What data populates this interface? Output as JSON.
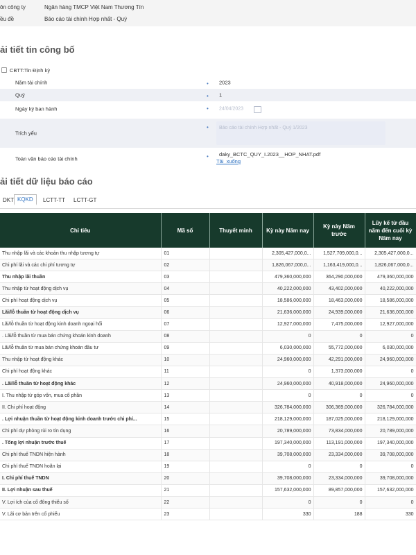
{
  "company": {
    "label": "ôn công ty",
    "value": "Ngân hàng TMCP Việt Nam Thương Tín"
  },
  "subject": {
    "label": "ều đề",
    "value": "Báo cáo tài chính Hợp nhất - Quý"
  },
  "section1_title": "ải tiết tin công bố",
  "cbtt": "CBTT:Tin Định kỳ",
  "fields": [
    {
      "label": "Năm tài chính",
      "value": "2023"
    },
    {
      "label": "Quý",
      "value": "1"
    },
    {
      "label": "Ngày ký ban hành",
      "value": "24/04/2023"
    },
    {
      "label": "Trích yếu",
      "value": "Báo cáo tài chính Hợp nhất - Quý 1/2023"
    },
    {
      "label": "Toàn văn báo cáo tài chính",
      "value": "daky_BCTC_QUY_I.2023__HOP_NHAT.pdf",
      "link": "Tải_xuống"
    }
  ],
  "section2_title": "ải tiết dữ liệu báo cáo",
  "tabs": [
    "DKT",
    "KQKD",
    "LCTT-TT",
    "LCTT-GT"
  ],
  "active_tab": 1,
  "table": {
    "headers": [
      "Chỉ tiêu",
      "Mã số",
      "Thuyết minh",
      "Kỳ này Năm nay",
      "Kỳ này Năm trước",
      "Lũy kế từ đầu năm đến cuối kỳ Năm nay"
    ],
    "rows": [
      {
        "name": "Thu nhập lãi và các khoản thu nhập tương tự",
        "code": "01",
        "note": "",
        "cur": "2,305,427,000,0...",
        "prev": "1,527,709,000,0...",
        "ytd": "2,305,427,000,0...",
        "bold": false
      },
      {
        "name": "Chi phí lãi và các chi phí tương tự",
        "code": "02",
        "note": "",
        "cur": "1,826,067,000,0...",
        "prev": "1,163,419,000,0...",
        "ytd": "1,826,067,000,0...",
        "bold": false
      },
      {
        "name": "Thu nhập lãi thuần",
        "code": "03",
        "note": "",
        "cur": "479,360,000,000",
        "prev": "364,290,000,000",
        "ytd": "479,360,000,000",
        "bold": true
      },
      {
        "name": "Thu nhập từ hoạt động dịch vụ",
        "code": "04",
        "note": "",
        "cur": "40,222,000,000",
        "prev": "43,402,000,000",
        "ytd": "40,222,000,000",
        "bold": false
      },
      {
        "name": "Chi phí hoạt động dịch vụ",
        "code": "05",
        "note": "",
        "cur": "18,586,000,000",
        "prev": "18,463,000,000",
        "ytd": "18,586,000,000",
        "bold": false
      },
      {
        "name": "Lãi/lỗ thuần từ hoạt động dịch vụ",
        "code": "06",
        "note": "",
        "cur": "21,636,000,000",
        "prev": "24,939,000,000",
        "ytd": "21,636,000,000",
        "bold": true
      },
      {
        "name": "Lãi/lỗ thuần từ hoạt động kinh doanh ngoại hối",
        "code": "07",
        "note": "",
        "cur": "12,927,000,000",
        "prev": "7,475,000,000",
        "ytd": "12,927,000,000",
        "bold": false
      },
      {
        "name": ". Lãi/lỗ thuần từ mua bán chứng khoán kinh doanh",
        "code": "08",
        "note": "",
        "cur": "0",
        "prev": "0",
        "ytd": "0",
        "bold": false
      },
      {
        "name": "Lãi/lỗ thuần từ mua bán chứng khoán đầu tư",
        "code": "09",
        "note": "",
        "cur": "6,030,000,000",
        "prev": "55,772,000,000",
        "ytd": "6,030,000,000",
        "bold": false
      },
      {
        "name": "Thu nhập từ hoạt động khác",
        "code": "10",
        "note": "",
        "cur": "24,960,000,000",
        "prev": "42,291,000,000",
        "ytd": "24,960,000,000",
        "bold": false
      },
      {
        "name": "Chi phí hoạt động khác",
        "code": "11",
        "note": "",
        "cur": "0",
        "prev": "1,373,000,000",
        "ytd": "0",
        "bold": false
      },
      {
        "name": ". Lãi/lỗ thuần từ hoạt động khác",
        "code": "12",
        "note": "",
        "cur": "24,960,000,000",
        "prev": "40,918,000,000",
        "ytd": "24,960,000,000",
        "bold": true
      },
      {
        "name": "I. Thu nhập từ góp vốn, mua cổ phần",
        "code": "13",
        "note": "",
        "cur": "0",
        "prev": "0",
        "ytd": "0",
        "bold": false
      },
      {
        "name": "II. Chi phí hoạt động",
        "code": "14",
        "note": "",
        "cur": "326,784,000,000",
        "prev": "306,369,000,000",
        "ytd": "326,784,000,000",
        "bold": false
      },
      {
        "name": ". Lợi nhuận thuần từ hoạt động kinh doanh trước chi phí...",
        "code": "15",
        "note": "",
        "cur": "218,129,000,000",
        "prev": "187,025,000,000",
        "ytd": "218,129,000,000",
        "bold": true
      },
      {
        "name": "Chi phí dự phòng rủi ro tín dụng",
        "code": "16",
        "note": "",
        "cur": "20,789,000,000",
        "prev": "73,834,000,000",
        "ytd": "20,789,000,000",
        "bold": false
      },
      {
        "name": ". Tổng lợi nhuận trước thuế",
        "code": "17",
        "note": "",
        "cur": "197,340,000,000",
        "prev": "113,191,000,000",
        "ytd": "197,340,000,000",
        "bold": true
      },
      {
        "name": "Chi phí thuế TNDN hiện hành",
        "code": "18",
        "note": "",
        "cur": "39,708,000,000",
        "prev": "23,334,000,000",
        "ytd": "39,708,000,000",
        "bold": false
      },
      {
        "name": "Chi phí thuế TNDN hoãn lại",
        "code": "19",
        "note": "",
        "cur": "0",
        "prev": "0",
        "ytd": "0",
        "bold": false
      },
      {
        "name": "I. Chi phí thuế TNDN",
        "code": "20",
        "note": "",
        "cur": "39,708,000,000",
        "prev": "23,334,000,000",
        "ytd": "39,708,000,000",
        "bold": true
      },
      {
        "name": "II. Lợi nhuận sau thuế",
        "code": "21",
        "note": "",
        "cur": "157,632,000,000",
        "prev": "89,857,000,000",
        "ytd": "157,632,000,000",
        "bold": true
      },
      {
        "name": "V. Lợi ích của cổ đông thiểu số",
        "code": "22",
        "note": "",
        "cur": "0",
        "prev": "0",
        "ytd": "0",
        "bold": false
      },
      {
        "name": "V. Lãi cơ bản trên cổ phiếu",
        "code": "23",
        "note": "",
        "cur": "330",
        "prev": "188",
        "ytd": "330",
        "bold": false
      }
    ]
  }
}
